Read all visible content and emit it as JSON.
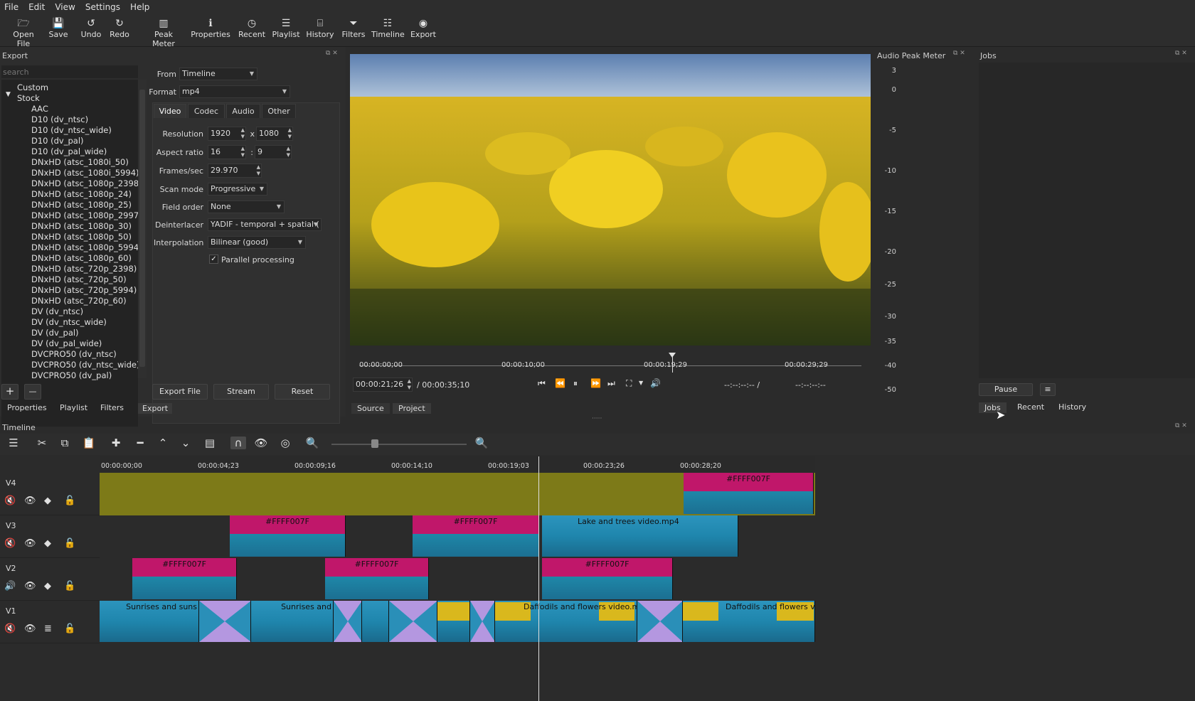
{
  "menu": [
    "File",
    "Edit",
    "View",
    "Settings",
    "Help"
  ],
  "toolbar": [
    {
      "label": "Open File",
      "icon": "folder-icon"
    },
    {
      "label": "Save",
      "icon": "save-icon"
    },
    {
      "label": "Undo",
      "icon": "undo-icon"
    },
    {
      "label": "Redo",
      "icon": "redo-icon"
    },
    {
      "label": "Peak Meter",
      "icon": "peak-meter-icon"
    },
    {
      "label": "Properties",
      "icon": "info-icon"
    },
    {
      "label": "Recent",
      "icon": "clock-icon"
    },
    {
      "label": "Playlist",
      "icon": "list-icon"
    },
    {
      "label": "History",
      "icon": "history-icon"
    },
    {
      "label": "Filters",
      "icon": "filter-icon"
    },
    {
      "label": "Timeline",
      "icon": "timeline-icon"
    },
    {
      "label": "Export",
      "icon": "export-icon"
    }
  ],
  "export": {
    "title": "Export",
    "search_placeholder": "search",
    "presets": [
      "Custom",
      "Stock",
      "AAC",
      "D10 (dv_ntsc)",
      "D10 (dv_ntsc_wide)",
      "D10 (dv_pal)",
      "D10 (dv_pal_wide)",
      "DNxHD (atsc_1080i_50)",
      "DNxHD (atsc_1080i_5994)",
      "DNxHD (atsc_1080p_2398)",
      "DNxHD (atsc_1080p_24)",
      "DNxHD (atsc_1080p_25)",
      "DNxHD (atsc_1080p_2997)",
      "DNxHD (atsc_1080p_30)",
      "DNxHD (atsc_1080p_50)",
      "DNxHD (atsc_1080p_5994)",
      "DNxHD (atsc_1080p_60)",
      "DNxHD (atsc_720p_2398)",
      "DNxHD (atsc_720p_50)",
      "DNxHD (atsc_720p_5994)",
      "DNxHD (atsc_720p_60)",
      "DV (dv_ntsc)",
      "DV (dv_ntsc_wide)",
      "DV (dv_pal)",
      "DV (dv_pal_wide)",
      "DVCPRO50 (dv_ntsc)",
      "DVCPRO50 (dv_ntsc_wide)",
      "DVCPRO50 (dv_pal)"
    ],
    "from_label": "From",
    "from_value": "Timeline",
    "format_label": "Format",
    "format_value": "mp4",
    "tabs": [
      "Video",
      "Codec",
      "Audio",
      "Other"
    ],
    "resolution_label": "Resolution",
    "res_w": "1920",
    "res_x": "x",
    "res_h": "1080",
    "aspect_label": "Aspect ratio",
    "asp_w": "16",
    "asp_sep": ":",
    "asp_h": "9",
    "fps_label": "Frames/sec",
    "fps_value": "29.970",
    "scan_label": "Scan mode",
    "scan_value": "Progressive",
    "field_label": "Field order",
    "field_value": "None",
    "deint_label": "Deinterlacer",
    "deint_value": "YADIF - temporal + spatial (",
    "interp_label": "Interpolation",
    "interp_value": "Bilinear (good)",
    "parallel_label": "Parallel processing",
    "parallel_check": "✓",
    "export_file": "Export File",
    "stream": "Stream",
    "reset": "Reset",
    "add": "+",
    "remove": "—"
  },
  "bottom_tabs": [
    "Properties",
    "Playlist",
    "Filters",
    "Export"
  ],
  "player": {
    "ruler": [
      "00:00:00;00",
      "00:00:10;00",
      "00:00:19;29",
      "00:00:29;29"
    ],
    "position": "00:00:21;26",
    "duration": "/ 00:00:35;10",
    "in_point": "--:--:--:-- /",
    "out_point": "--:--:--:--",
    "tabs": [
      "Source",
      "Project"
    ]
  },
  "peak": {
    "title": "Audio Peak Meter",
    "scale": [
      "3",
      "0",
      "-5",
      "-10",
      "-15",
      "-20",
      "-25",
      "-30",
      "-35",
      "-40",
      "-50"
    ]
  },
  "jobs": {
    "title": "Jobs",
    "pause": "Pause",
    "menu": "≡",
    "tabs": [
      "Jobs",
      "Recent",
      "History"
    ]
  },
  "timeline": {
    "title": "Timeline",
    "ruler": [
      "00:00:00;00",
      "00:00:04;23",
      "00:00:09;16",
      "00:00:14;10",
      "00:00:19;03",
      "00:00:23;26",
      "00:00:28;20"
    ],
    "tracks": [
      "V4",
      "V3",
      "V2",
      "V1"
    ],
    "clip_color": "#FFFF007F",
    "clips": {
      "v4": [
        "#FFFF007F"
      ],
      "v3": [
        "#FFFF007F",
        "#FFFF007F",
        "Lake and trees video.mp4"
      ],
      "v2": [
        "#FFFF007F",
        "#FFFF007F",
        "#FFFF007F"
      ],
      "v1": [
        "Sunrises and suns",
        "Sunrises and",
        "Daffodils and flowers video.m",
        "Daffodils and flowers video"
      ]
    }
  },
  "colors": {
    "accent": "#c0176a",
    "clip_blue": "#2a8fb8",
    "v4_fill": "#7d7a18",
    "trans": "#b497e0"
  }
}
